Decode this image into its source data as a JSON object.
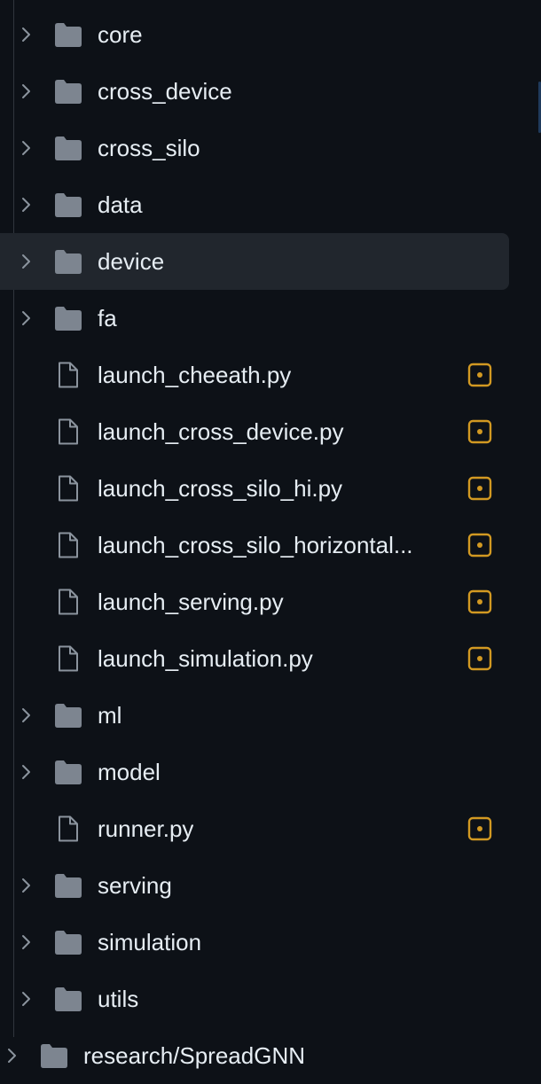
{
  "colors": {
    "background": "#0d1117",
    "selected_row": "#21262d",
    "folder_icon": "#7d8590",
    "file_icon": "#8b949e",
    "badge": "#d29922",
    "text": "#e6edf3"
  },
  "tree": {
    "items": [
      {
        "type": "folder",
        "name": "core",
        "level": 1,
        "badge": false,
        "selected": false,
        "icon": "folder-icon"
      },
      {
        "type": "folder",
        "name": "cross_device",
        "level": 1,
        "badge": false,
        "selected": false,
        "icon": "folder-icon"
      },
      {
        "type": "folder",
        "name": "cross_silo",
        "level": 1,
        "badge": false,
        "selected": false,
        "icon": "folder-icon"
      },
      {
        "type": "folder",
        "name": "data",
        "level": 1,
        "badge": false,
        "selected": false,
        "icon": "folder-icon"
      },
      {
        "type": "folder",
        "name": "device",
        "level": 1,
        "badge": false,
        "selected": true,
        "icon": "folder-icon"
      },
      {
        "type": "folder",
        "name": "fa",
        "level": 1,
        "badge": false,
        "selected": false,
        "icon": "folder-icon"
      },
      {
        "type": "file",
        "name": "launch_cheeath.py",
        "level": 1,
        "badge": true,
        "selected": false,
        "icon": "file-icon"
      },
      {
        "type": "file",
        "name": "launch_cross_device.py",
        "level": 1,
        "badge": true,
        "selected": false,
        "icon": "file-icon"
      },
      {
        "type": "file",
        "name": "launch_cross_silo_hi.py",
        "level": 1,
        "badge": true,
        "selected": false,
        "icon": "file-icon"
      },
      {
        "type": "file",
        "name": "launch_cross_silo_horizontal...",
        "level": 1,
        "badge": true,
        "selected": false,
        "icon": "file-icon"
      },
      {
        "type": "file",
        "name": "launch_serving.py",
        "level": 1,
        "badge": true,
        "selected": false,
        "icon": "file-icon"
      },
      {
        "type": "file",
        "name": "launch_simulation.py",
        "level": 1,
        "badge": true,
        "selected": false,
        "icon": "file-icon"
      },
      {
        "type": "folder",
        "name": "ml",
        "level": 1,
        "badge": false,
        "selected": false,
        "icon": "folder-icon"
      },
      {
        "type": "folder",
        "name": "model",
        "level": 1,
        "badge": false,
        "selected": false,
        "icon": "folder-icon"
      },
      {
        "type": "file",
        "name": "runner.py",
        "level": 1,
        "badge": true,
        "selected": false,
        "icon": "file-icon"
      },
      {
        "type": "folder",
        "name": "serving",
        "level": 1,
        "badge": false,
        "selected": false,
        "icon": "folder-icon"
      },
      {
        "type": "folder",
        "name": "simulation",
        "level": 1,
        "badge": false,
        "selected": false,
        "icon": "folder-icon"
      },
      {
        "type": "folder",
        "name": "utils",
        "level": 1,
        "badge": false,
        "selected": false,
        "icon": "folder-icon"
      },
      {
        "type": "folder",
        "name": "research/SpreadGNN",
        "level": 0,
        "badge": false,
        "selected": false,
        "icon": "folder-icon"
      }
    ]
  }
}
